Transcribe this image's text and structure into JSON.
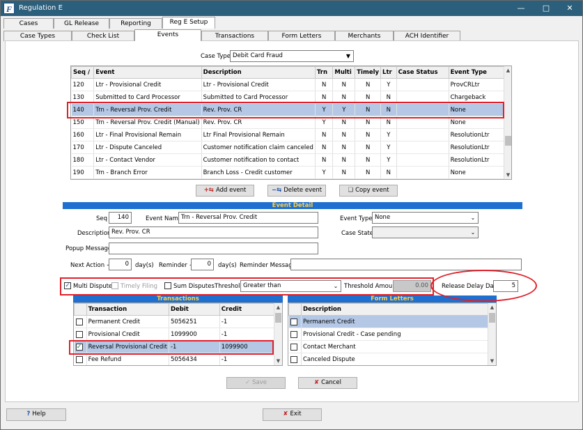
{
  "window": {
    "title": "Regulation E",
    "app_icon": "F"
  },
  "main_tabs": [
    "Cases",
    "GL Release",
    "Reporting",
    "Reg E Setup"
  ],
  "sub_tabs": [
    "Case Types",
    "Check List",
    "Events",
    "Transactions",
    "Form Letters",
    "Merchants",
    "ACH Identifier"
  ],
  "case_type": {
    "label": "Case Type",
    "value": "Debit Card Fraud"
  },
  "events_table": {
    "headers": [
      "Seq",
      "Event",
      "Description",
      "Trn",
      "Multi",
      "Timely",
      "Ltr",
      "Case Status",
      "Event Type"
    ],
    "rows": [
      [
        "120",
        "Ltr - Provisional Credit",
        "Ltr - Provisional Credit",
        "N",
        "N",
        "N",
        "Y",
        "",
        "ProvCRLtr"
      ],
      [
        "130",
        "Submitted to Card Processor",
        "Submitted to Card Processor",
        "N",
        "N",
        "N",
        "N",
        "",
        "Chargeback"
      ],
      [
        "140",
        "Trn - Reversal Prov. Credit",
        "Rev. Prov. CR",
        "Y",
        "Y",
        "N",
        "N",
        "",
        "None"
      ],
      [
        "150",
        "Trn - Reversal Prov. Credit (Manual)",
        "Rev. Prov. CR",
        "Y",
        "N",
        "N",
        "N",
        "",
        "None"
      ],
      [
        "160",
        "Ltr - Final Provisional Remain",
        "Ltr Final Provisional Remain",
        "N",
        "N",
        "N",
        "Y",
        "",
        "ResolutionLtr"
      ],
      [
        "170",
        "Ltr - Dispute Canceled",
        "Customer notification claim canceled",
        "N",
        "N",
        "N",
        "Y",
        "",
        "ResolutionLtr"
      ],
      [
        "180",
        "Ltr - Contact Vendor",
        "Customer notification to contact",
        "N",
        "N",
        "N",
        "Y",
        "",
        "ResolutionLtr"
      ],
      [
        "190",
        "Trn - Branch Error",
        "Branch Loss - Credit customer",
        "Y",
        "N",
        "N",
        "N",
        "",
        "None"
      ]
    ]
  },
  "buttons": {
    "add_event": "Add event",
    "delete_event": "Delete event",
    "copy_event": "Copy event",
    "save": "Save",
    "cancel": "Cancel",
    "help": "Help",
    "exit": "Exit"
  },
  "event_detail": {
    "header": "Event Detail",
    "seq_label": "Seq",
    "seq": "140",
    "event_name_label": "Event Name",
    "event_name": "Trn - Reversal Prov. Credit",
    "event_type_label": "Event Type",
    "event_type": "None",
    "description_label": "Description",
    "description": "Rev. Prov. CR",
    "case_state_label": "Case State",
    "case_state": "",
    "popup_label": "Popup Message",
    "popup": "",
    "next_action_label": "Next Action +",
    "next_action": "0",
    "days1": "day(s)",
    "reminder_label": "Reminder +",
    "reminder": "0",
    "days2": "day(s)",
    "reminder_msg_label": "Reminder Message",
    "reminder_msg": "",
    "multi_dispute": "Multi Dispute",
    "timely_filing": "Timely Filing",
    "sum_disputes": "Sum Disputes",
    "threshold_label": "Threshold",
    "threshold": "Greater than",
    "threshold_amount_label": "Threshold Amount",
    "threshold_amount": "0.00",
    "release_delay_label": "Release Delay Days",
    "release_delay": "5"
  },
  "transactions": {
    "header": "Transactions",
    "columns": [
      "Transaction",
      "Debit",
      "Credit"
    ],
    "rows": [
      [
        "Permanent Credit",
        "5056251",
        "-1"
      ],
      [
        "Provisional Credit",
        "1099900",
        "-1"
      ],
      [
        "Reversal Provisional Credit",
        "-1",
        "1099900"
      ],
      [
        "Fee Refund",
        "5056434",
        "-1"
      ]
    ]
  },
  "form_letters": {
    "header": "Form Letters",
    "columns": [
      "Description"
    ],
    "rows": [
      "Permanent Credit",
      "Provisional Credit - Case pending",
      "Contact Merchant",
      "Canceled Dispute"
    ]
  },
  "colors": {
    "titlebar": "#2b5f7c",
    "section": "#1e6fd0",
    "section_text": "#ffd24a",
    "selection": "#b4c8e6",
    "annotation": "#e0202a"
  }
}
